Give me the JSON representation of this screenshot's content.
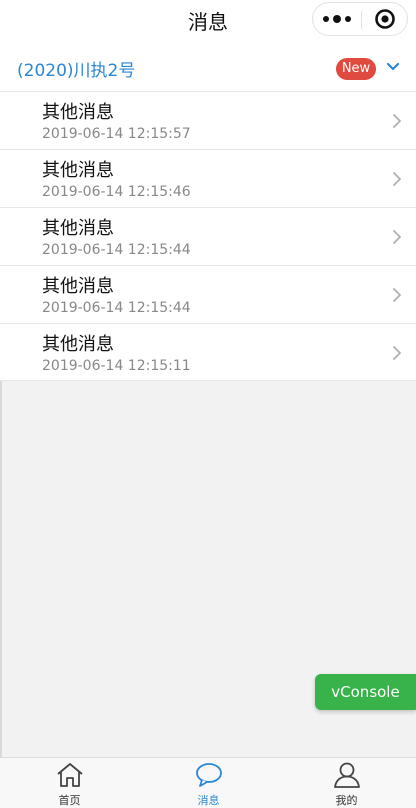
{
  "header": {
    "title": "消息"
  },
  "group": {
    "title": "(2020)川执2号",
    "badge": "New"
  },
  "messages": [
    {
      "title": "其他消息",
      "time": "2019-06-14 12:15:57"
    },
    {
      "title": "其他消息",
      "time": "2019-06-14 12:15:46"
    },
    {
      "title": "其他消息",
      "time": "2019-06-14 12:15:44"
    },
    {
      "title": "其他消息",
      "time": "2019-06-14 12:15:44"
    },
    {
      "title": "其他消息",
      "time": "2019-06-14 12:15:11"
    }
  ],
  "vconsole": {
    "label": "vConsole"
  },
  "tabbar": {
    "items": [
      {
        "label": "首页",
        "icon": "home-icon"
      },
      {
        "label": "消息",
        "icon": "chat-bubble-icon",
        "active": true
      },
      {
        "label": "我的",
        "icon": "user-icon"
      }
    ]
  },
  "colors": {
    "accent": "#2b86d6",
    "badge": "#e04a3f",
    "vconsole": "#37b34a"
  }
}
